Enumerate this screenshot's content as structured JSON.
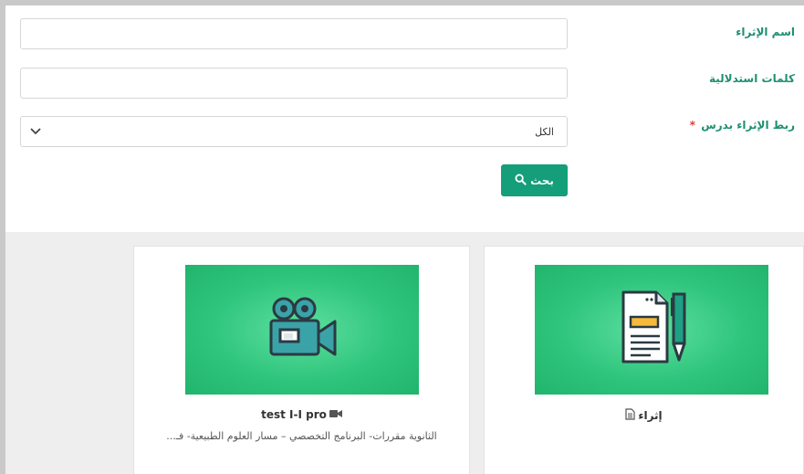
{
  "form": {
    "name_label": "اسم الإثراء",
    "keywords_label": "كلمات استدلالية",
    "link_label": "ربط الإثراء بدرس",
    "required_mark": "*",
    "name_value": "",
    "keywords_value": "",
    "select_value": "الكل",
    "search_button_label": "بحث"
  },
  "cards": [
    {
      "icon": "document-pen-illustration",
      "type_icon": "document-icon",
      "title": "إثراء",
      "description": ""
    },
    {
      "icon": "video-camera-illustration",
      "type_icon": "video-camera-icon",
      "title": "test I-I pro",
      "description": "الثانوية مقررات- البرنامج التخصصي – مسار العلوم الطبيعية- فـ..."
    }
  ],
  "colors": {
    "accent": "#149e7a",
    "label": "#1f8f72",
    "thumbnail": "#2fc57d"
  }
}
